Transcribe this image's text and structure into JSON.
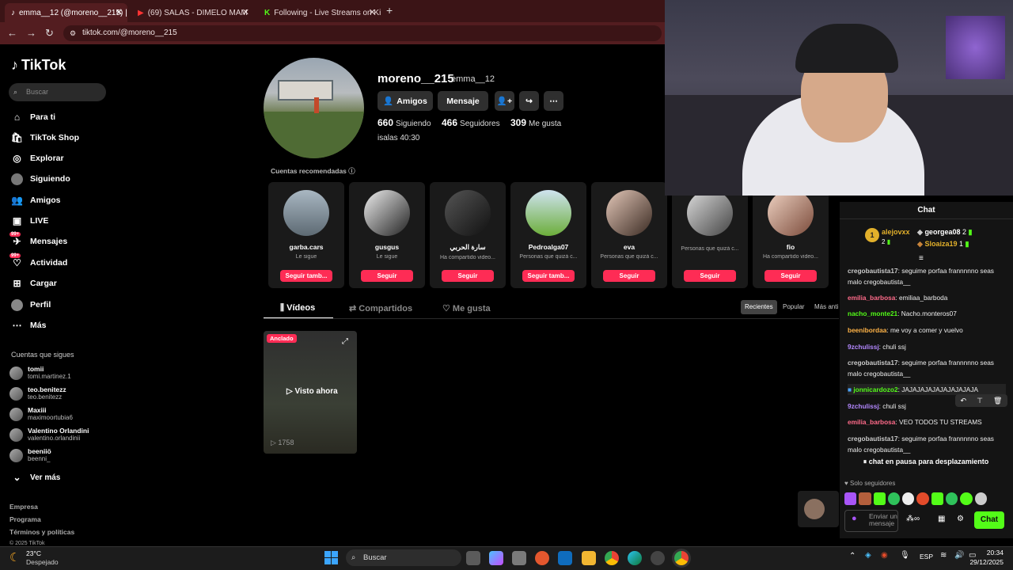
{
  "browser": {
    "tabs": [
      {
        "label": "emma__12 (@moreno__215) | T",
        "active": true
      },
      {
        "label": "(69) SALAS - DIMELO MAM",
        "active": false
      },
      {
        "label": "Following - Live Streams on Kic",
        "active": false
      }
    ],
    "url": "tiktok.com/@moreno__215"
  },
  "sidebar": {
    "logo": "TikTok",
    "search_placeholder": "Buscar",
    "nav": [
      {
        "label": "Para ti",
        "icon": "home-icon"
      },
      {
        "label": "TikTok Shop",
        "icon": "shop-icon"
      },
      {
        "label": "Explorar",
        "icon": "compass-icon"
      },
      {
        "label": "Siguiendo",
        "icon": "following-icon"
      },
      {
        "label": "Amigos",
        "icon": "friends-icon"
      },
      {
        "label": "LIVE",
        "icon": "live-icon"
      },
      {
        "label": "Mensajes",
        "icon": "messages-icon",
        "badge": "99+"
      },
      {
        "label": "Actividad",
        "icon": "activity-icon",
        "badge": "99+"
      },
      {
        "label": "Cargar",
        "icon": "upload-icon"
      },
      {
        "label": "Perfil",
        "icon": "profile-icon"
      },
      {
        "label": "Más",
        "icon": "more-icon"
      }
    ],
    "following_header": "Cuentas que sigues",
    "following": [
      {
        "name": "tomii",
        "handle": "tomi.martinez.1"
      },
      {
        "name": "teo.benitezz",
        "handle": "teo.benitezz"
      },
      {
        "name": "Maxiii",
        "handle": "maximoortubia6"
      },
      {
        "name": "Valentino Orlandini",
        "handle": "valentino.orlandinii"
      },
      {
        "name": "beeniiö",
        "handle": "beenni_"
      }
    ],
    "see_more": "Ver más",
    "footer": [
      "Empresa",
      "Programa",
      "Términos y políticas",
      "© 2025 TikTok"
    ]
  },
  "profile": {
    "username": "moreno__215",
    "nickname": "emma__12",
    "friends_btn": "Amigos",
    "message_btn": "Mensaje",
    "following_count": "660",
    "following_label": "Siguiendo",
    "followers_count": "466",
    "followers_label": "Seguidores",
    "likes_count": "309",
    "likes_label": "Me gusta",
    "bio": "isalas 40:30",
    "recommended_header": "Cuentas recomendadas",
    "recommended": [
      {
        "name": "garba.cars",
        "sub": "Le sigue",
        "btn": "Seguir tamb..."
      },
      {
        "name": "gusgus",
        "sub": "Le sigue",
        "btn": "Seguir"
      },
      {
        "name": "سارة الحربي",
        "sub": "Ha compartido video...",
        "btn": "Seguir"
      },
      {
        "name": "Pedroalga07",
        "sub": "Personas que quizá c...",
        "btn": "Seguir tamb..."
      },
      {
        "name": "eva",
        "sub": "Personas que quizá c...",
        "btn": "Seguir"
      },
      {
        "name": "",
        "sub": "Personas que quizá c...",
        "btn": "Seguir"
      },
      {
        "name": "fio",
        "sub": "Ha compartido video...",
        "btn": "Seguir"
      }
    ],
    "tabs": [
      "Vídeos",
      "Compartidos",
      "Me gusta"
    ],
    "sort": [
      "Recientes",
      "Popular",
      "Más anti"
    ],
    "video": {
      "pinned": "Anclado",
      "watched": "Visto ahora",
      "views": "1758"
    }
  },
  "chat": {
    "title": "Chat",
    "top": [
      {
        "name": "alejovxx",
        "count": "2",
        "rank": "1"
      },
      {
        "name": "georgea08",
        "count": "2"
      },
      {
        "name": "Sloaiza19",
        "count": "1"
      }
    ],
    "messages": [
      {
        "user": "cregobautista17",
        "text": "seguime porfaa frannnnno seas malo cregobautista__",
        "color": "#c9c9c9"
      },
      {
        "user": "emilia_barbosa",
        "text": "emiliaa_barboda",
        "color": "#ff6b8a"
      },
      {
        "user": "nacho_monte21",
        "text": "Nacho.monteros07",
        "color": "#53fc18"
      },
      {
        "user": "beenibordaa",
        "text": "me voy a comer y vuelvo",
        "color": "#ffb347"
      },
      {
        "user": "9zchulissj",
        "text": "chuli ssj",
        "color": "#b388ff"
      },
      {
        "user": "cregobautista17",
        "text": "seguime porfaa frannnnno seas malo cregobautista__",
        "color": "#c9c9c9"
      },
      {
        "user": "jonnicardozo2",
        "text": "JAJAJAJAJAJAJAJAJAJA",
        "color": "#53fc18"
      },
      {
        "user": "9zchulissj",
        "text": "chuli ssj",
        "color": "#b388ff"
      },
      {
        "user": "emilia_barbosa",
        "text": "VEO TODOS TU STREAMS",
        "color": "#ff6b8a"
      },
      {
        "user": "cregobautista17",
        "text": "seguime porfaa frannnnno seas malo cregobautista__",
        "color": "#c9c9c9"
      }
    ],
    "paused": "chat en pausa para desplazamiento",
    "followers_only": "Solo seguidores",
    "input_placeholder": "Enviar un mensaje",
    "send_btn": "Chat"
  },
  "taskbar": {
    "weather_temp": "23°C",
    "weather_desc": "Despejado",
    "search": "Buscar",
    "lang": "ESP",
    "time": "20:34",
    "date": "29/12/2025"
  },
  "colors": {
    "tiktok_red": "#fe2c55",
    "kick_green": "#53fc18"
  }
}
